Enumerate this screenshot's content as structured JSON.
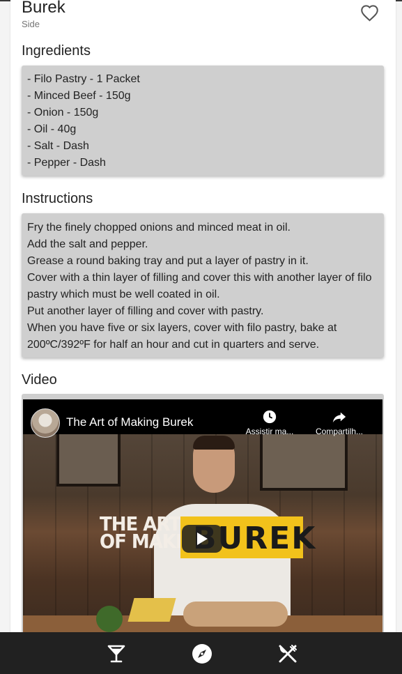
{
  "meal": {
    "title": "Burek",
    "category": "Side"
  },
  "ingredients": {
    "heading": "Ingredients",
    "items": [
      "- Filo Pastry - 1 Packet",
      "- Minced Beef - 150g",
      "- Onion - 150g",
      "- Oil - 40g",
      "- Salt - Dash",
      "- Pepper - Dash"
    ]
  },
  "instructions": {
    "heading": "Instructions",
    "lines": [
      "Fry the finely chopped onions and minced meat in oil.",
      "Add the salt and pepper.",
      "Grease a round baking tray and put a layer of pastry in it.",
      "Cover with a thin layer of filling and cover this with another layer of filo pastry which must be well coated in oil.",
      "Put another layer of filling and cover with pastry.",
      "When you have five or six layers, cover with filo pastry, bake at 200ºC/392ºF for half an hour and cut in quarters and serve."
    ]
  },
  "video": {
    "heading": "Video",
    "title": "The Art of Making Burek",
    "watch_later_label": "Assistir ma...",
    "share_label": "Compartilh...",
    "thumbnail_text_left_1": "THE ART",
    "thumbnail_text_left_2": "OF MAKING",
    "thumbnail_text_right": "BUREK"
  },
  "nav": {
    "items": [
      {
        "icon": "cocktail-icon"
      },
      {
        "icon": "compass-icon"
      },
      {
        "icon": "utensils-icon"
      }
    ]
  },
  "colors": {
    "card_bg": "#cfcfcf",
    "nav_bg": "#212121",
    "banner_yellow": "#f2c21b"
  }
}
